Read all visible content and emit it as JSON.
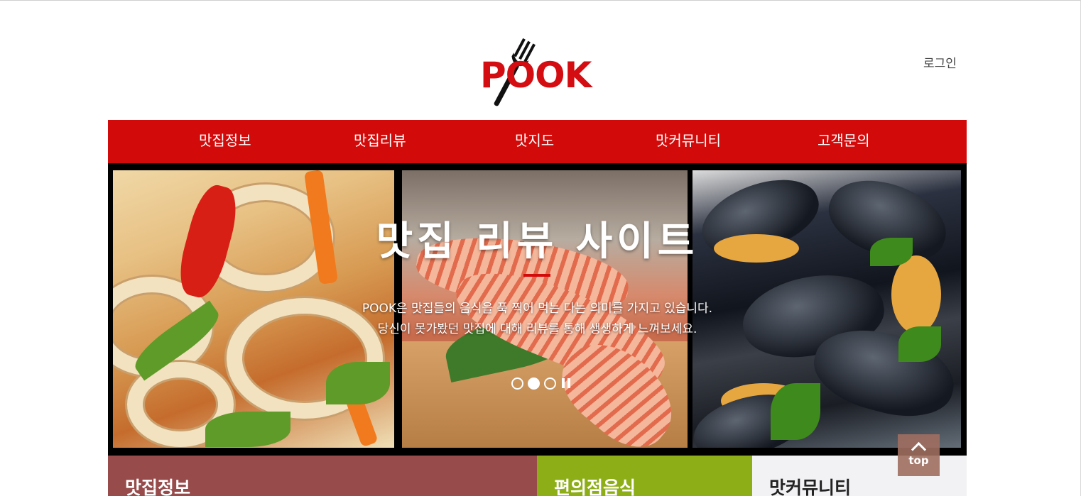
{
  "header": {
    "logo_text": "POOK",
    "login_label": "로그인"
  },
  "nav": {
    "items": [
      {
        "label": "맛집정보"
      },
      {
        "label": "맛집리뷰"
      },
      {
        "label": "맛지도"
      },
      {
        "label": "맛커뮤니티"
      },
      {
        "label": "고객문의"
      }
    ]
  },
  "hero": {
    "title": "맛집 리뷰 사이트",
    "desc_line1": "POOK은 맛집들의 음식을 푹 찍어 먹는 다는 의미를 가지고 있습니다.",
    "desc_line2": "당신이 못가봤던 맛집에 대해 리뷰를 통해 생생하게 느껴보세요.",
    "slide_count": 3,
    "active_slide": 2,
    "accent_color": "#d20a0a"
  },
  "sections": {
    "box1": "맛집정보",
    "box2": "편의점음식",
    "box3": "맛커뮤니티"
  },
  "top_button": {
    "label": "top"
  },
  "colors": {
    "brand_red": "#d20a0a",
    "box1": "#974b4b",
    "box2": "#8eae17",
    "box3": "#f2f2f4"
  }
}
